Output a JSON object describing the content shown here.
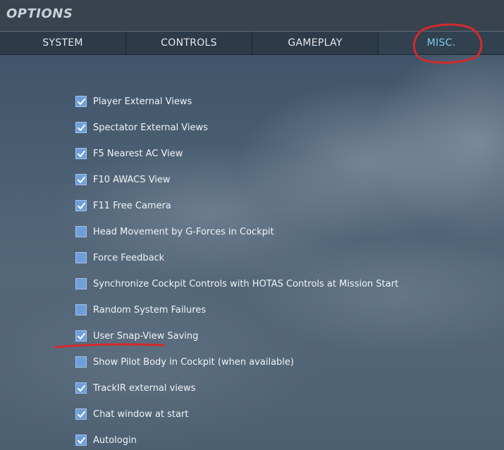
{
  "window": {
    "title": "OPTIONS"
  },
  "tabs": [
    {
      "label": "SYSTEM",
      "active": false
    },
    {
      "label": "CONTROLS",
      "active": false
    },
    {
      "label": "GAMEPLAY",
      "active": false
    },
    {
      "label": "MISC.",
      "active": true
    }
  ],
  "options": [
    {
      "label": "Player External Views",
      "checked": true
    },
    {
      "label": "Spectator External Views",
      "checked": true
    },
    {
      "label": "F5 Nearest AC View",
      "checked": true
    },
    {
      "label": "F10 AWACS View",
      "checked": true
    },
    {
      "label": "F11 Free Camera",
      "checked": true
    },
    {
      "label": "Head Movement by G-Forces in Cockpit",
      "checked": false
    },
    {
      "label": "Force Feedback",
      "checked": false
    },
    {
      "label": "Synchronize Cockpit Controls with HOTAS Controls at Mission Start",
      "checked": false
    },
    {
      "label": "Random System Failures",
      "checked": false
    },
    {
      "label": "User Snap-View Saving",
      "checked": true
    },
    {
      "label": "Show Pilot Body in Cockpit (when available)",
      "checked": false
    },
    {
      "label": "TrackIR external views",
      "checked": true
    },
    {
      "label": "Chat window at start",
      "checked": true
    },
    {
      "label": "Autologin",
      "checked": true
    }
  ],
  "colors": {
    "checkbox_fill": "#6f9fd9",
    "active_tab_text": "#7ccbe8",
    "annotation": "#d42a2a"
  }
}
